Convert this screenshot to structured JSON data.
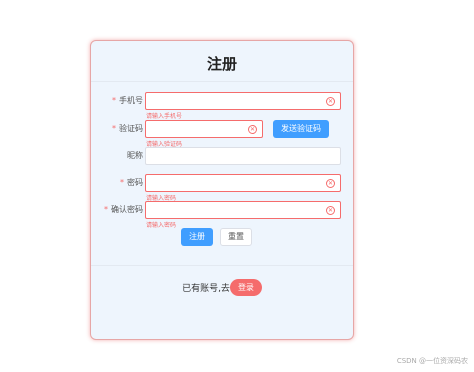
{
  "form": {
    "title": "注册",
    "fields": [
      {
        "label": "手机号",
        "required": true,
        "value": "",
        "placeholder": "",
        "error": "请输入手机号"
      },
      {
        "label": "验证码",
        "required": true,
        "value": "",
        "placeholder": "",
        "error": "请输入验证码"
      },
      {
        "label": "昵称",
        "required": false,
        "value": "",
        "placeholder": "",
        "error": ""
      },
      {
        "label": "密码",
        "required": true,
        "value": "",
        "placeholder": "",
        "error": "请输入密码"
      },
      {
        "label": "确认密码",
        "required": true,
        "value": "",
        "placeholder": "",
        "error": "请输入密码"
      }
    ],
    "send_code_label": "发送验证码",
    "submit_label": "注册",
    "reset_label": "重置",
    "required_mark": "*"
  },
  "footer": {
    "text": "已有账号,去",
    "login_label": "登录"
  },
  "watermark": "CSDN @一位资深码农",
  "colors": {
    "primary": "#409eff",
    "danger": "#f56c6c",
    "card_background": "#eef5fd"
  }
}
